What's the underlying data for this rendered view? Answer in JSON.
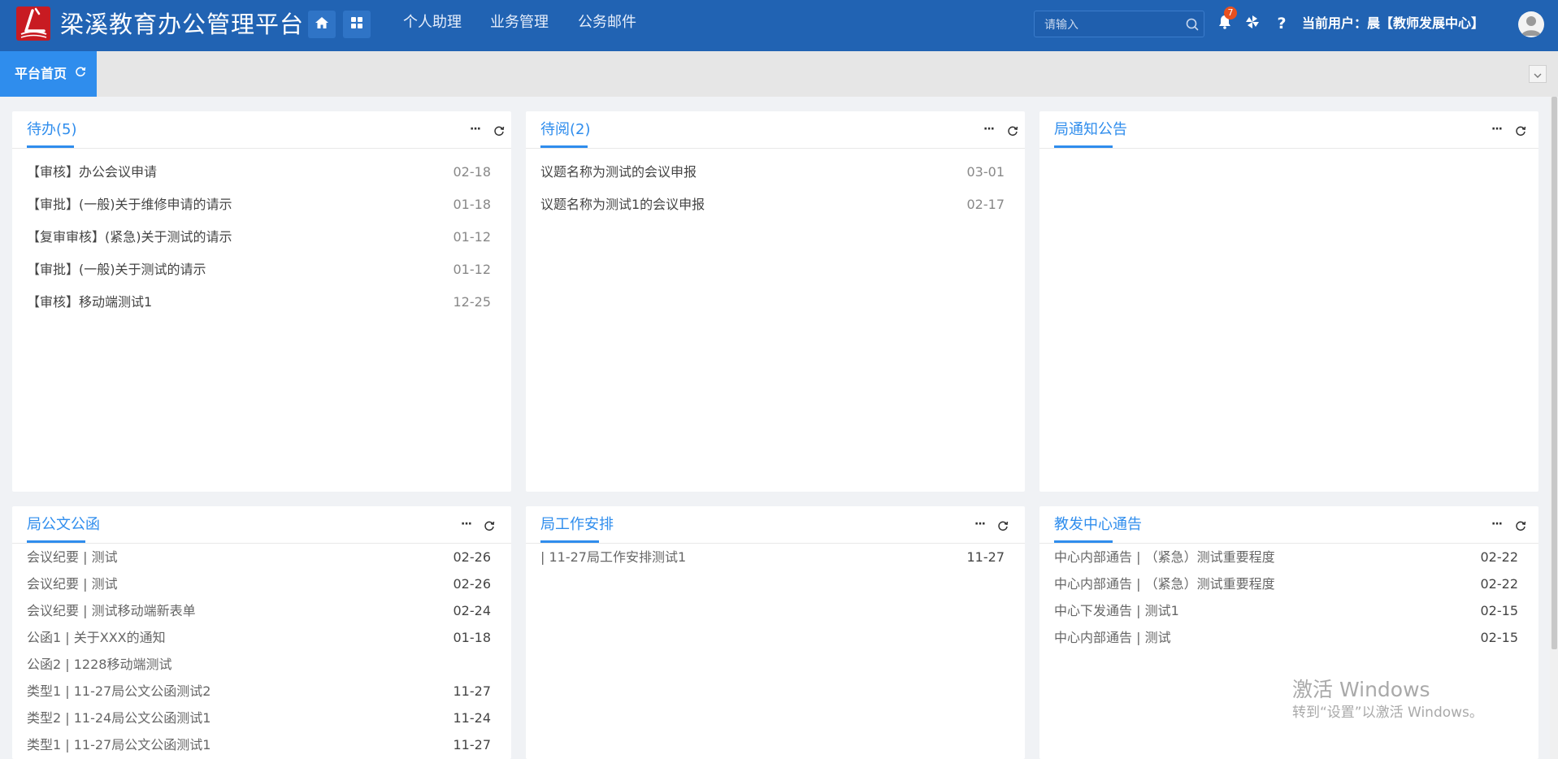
{
  "app": {
    "title": "梁溪教育办公管理平台",
    "nav": [
      "个人助理",
      "业务管理",
      "公务邮件"
    ],
    "search_placeholder": "请输入",
    "notification_count": "7",
    "current_user": "当前用户：晨【教师发展中心】",
    "help": "?"
  },
  "tabs": {
    "active_label": "平台首页"
  },
  "colors": {
    "header_bg": "#2163b3",
    "accent": "#2f8ded",
    "logo_red": "#c81b22",
    "badge": "#e8501f"
  },
  "panels": {
    "todo": {
      "title": "待办(5)",
      "more": "···",
      "items": [
        {
          "text": "【审核】办公会议申请",
          "date": "02-18"
        },
        {
          "text": "【审批】(一般)关于维修申请的请示",
          "date": "01-18"
        },
        {
          "text": "【复审审核】(紧急)关于测试的请示",
          "date": "01-12"
        },
        {
          "text": "【审批】(一般)关于测试的请示",
          "date": "01-12"
        },
        {
          "text": "【审核】移动端测试1",
          "date": "12-25"
        }
      ]
    },
    "toread": {
      "title": "待阅(2)",
      "more": "···",
      "items": [
        {
          "text": "议题名称为测试的会议申报",
          "date": "03-01"
        },
        {
          "text": "议题名称为测试1的会议申报",
          "date": "02-17"
        }
      ]
    },
    "bureau_notice": {
      "title": "局通知公告",
      "more": "···",
      "items": []
    },
    "bureau_docs": {
      "title": "局公文公函",
      "more": "···",
      "items": [
        {
          "text": "会议纪要 | 测试",
          "date": "02-26"
        },
        {
          "text": "会议纪要 | 测试",
          "date": "02-26"
        },
        {
          "text": "会议纪要 | 测试移动端新表单",
          "date": "02-24"
        },
        {
          "text": "公函1 | 关于XXX的通知",
          "date": "01-18"
        },
        {
          "text": "公函2 | 1228移动端测试",
          "date": ""
        },
        {
          "text": "类型1 | 11-27局公文公函测试2",
          "date": "11-27"
        },
        {
          "text": "类型2 | 11-24局公文公函测试1",
          "date": "11-24"
        },
        {
          "text": "类型1 | 11-27局公文公函测试1",
          "date": "11-27"
        }
      ]
    },
    "bureau_schedule": {
      "title": "局工作安排",
      "more": "···",
      "items": [
        {
          "text": "| 11-27局工作安排测试1",
          "date": "11-27"
        }
      ]
    },
    "center_notice": {
      "title": "教发中心通告",
      "more": "···",
      "items": [
        {
          "text": "中心内部通告 | （紧急）测试重要程度",
          "date": "02-22"
        },
        {
          "text": "中心内部通告 | （紧急）测试重要程度",
          "date": "02-22"
        },
        {
          "text": "中心下发通告 | 测试1",
          "date": "02-15"
        },
        {
          "text": "中心内部通告 | 测试",
          "date": "02-15"
        }
      ]
    }
  },
  "watermark": {
    "line1": "激活 Windows",
    "line2": "转到“设置”以激活 Windows。"
  }
}
